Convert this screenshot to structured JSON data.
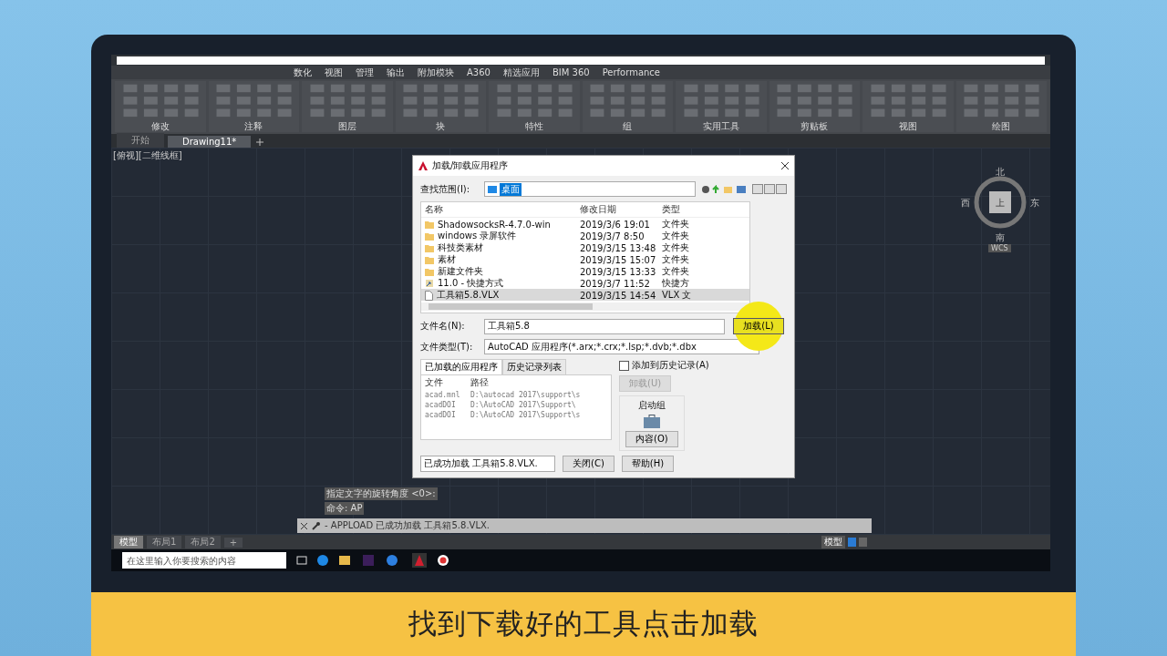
{
  "menu_tabs": [
    "数化",
    "视图",
    "管理",
    "输出",
    "附加模块",
    "A360",
    "精选应用",
    "BIM 360",
    "Performance"
  ],
  "ribbon_panels": [
    "修改",
    "注释",
    "图层",
    "块",
    "特性",
    "组",
    "实用工具",
    "剪贴板",
    "视图",
    "绘图"
  ],
  "file_tabs": [
    {
      "label": "开始",
      "selected": false
    },
    {
      "label": "Drawing11*",
      "selected": true
    }
  ],
  "viewport_label": "[俯视][二维线框]",
  "compass": {
    "north": "北",
    "west": "西",
    "east": "东",
    "south": "南",
    "top": "上",
    "ucs": "WCS"
  },
  "dialog": {
    "title": "加载/卸载应用程序",
    "look_in_label": "查找范围(I):",
    "look_in_value": "桌面",
    "columns": [
      "名称",
      "修改日期",
      "类型"
    ],
    "rows": [
      {
        "kind": "folder",
        "name": "ShadowsocksR-4.7.0-win",
        "date": "2019/3/6 19:01",
        "type": "文件夹",
        "selected": false
      },
      {
        "kind": "folder",
        "name": "windows 录屏软件",
        "date": "2019/3/7 8:50",
        "type": "文件夹",
        "selected": false
      },
      {
        "kind": "folder",
        "name": "科技类素材",
        "date": "2019/3/15 13:48",
        "type": "文件夹",
        "selected": false
      },
      {
        "kind": "folder",
        "name": "素材",
        "date": "2019/3/15 15:07",
        "type": "文件夹",
        "selected": false
      },
      {
        "kind": "folder",
        "name": "新建文件夹",
        "date": "2019/3/15 13:33",
        "type": "文件夹",
        "selected": false
      },
      {
        "kind": "shortcut",
        "name": "11.0 - 快捷方式",
        "date": "2019/3/7 11:52",
        "type": "快捷方",
        "selected": false
      },
      {
        "kind": "file",
        "name": "工具箱5.8.VLX",
        "date": "2019/3/15 14:54",
        "type": "VLX 文",
        "selected": true
      }
    ],
    "file_name_label": "文件名(N):",
    "file_name": "工具箱5.8",
    "load_button": "加载(L)",
    "file_type_label": "文件类型(T):",
    "file_type": "AutoCAD 应用程序(*.arx;*.crx;*.lsp;*.dvb;*.dbx",
    "tabs": [
      {
        "label": "已加载的应用程序",
        "selected": true
      },
      {
        "label": "历史记录列表",
        "selected": false
      }
    ],
    "history_checkbox": {
      "label": "添加到历史记录(A)",
      "checked": false
    },
    "loaded_columns": [
      "文件",
      "路径"
    ],
    "loaded_rows": [
      {
        "file": "acad.mnl",
        "path": "D:\\autocad 2017\\support\\s"
      },
      {
        "file": "acadDOI",
        "path": "D:\\AutoCAD 2017\\Support\\"
      },
      {
        "file": "acadDOI",
        "path": "D:\\AutoCAD 2017\\Support\\s"
      }
    ],
    "unload_button": {
      "label": "卸载(U)",
      "disabled": true
    },
    "startup_label": "启动组",
    "contents_button": "内容(O)",
    "status": "已成功加载 工具箱5.8.VLX.",
    "close_button": "关闭(C)",
    "help_button": "帮助(H)"
  },
  "command_history": [
    "指定文字的旋转角度 <0>:",
    "命令: AP"
  ],
  "command_line": "- APPLOAD 已成功加载 工具箱5.8.VLX.",
  "layout_tabs": [
    {
      "label": "模型",
      "selected": true
    },
    {
      "label": "布局1",
      "selected": false
    },
    {
      "label": "布局2",
      "selected": false
    }
  ],
  "add_layout": "+",
  "status_model": "模型",
  "taskbar": {
    "search_placeholder": "在这里输入你要搜索的内容"
  },
  "subtitle": "找到下载好的工具点击加载"
}
